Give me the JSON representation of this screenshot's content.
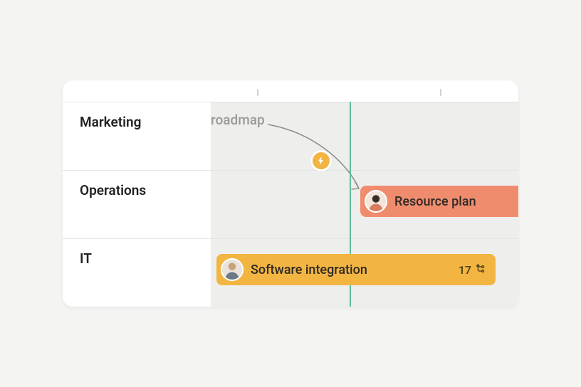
{
  "rows": [
    {
      "label": "Marketing"
    },
    {
      "label": "Operations"
    },
    {
      "label": "IT"
    }
  ],
  "ghost_task_label": "roadmap",
  "tasks": {
    "resource": {
      "title": "Resource plan",
      "color": "orange"
    },
    "software": {
      "title": "Software integration",
      "count": "17",
      "color": "yellow"
    }
  },
  "colors": {
    "today": "#5cbfa0",
    "bolt": "#f2b542",
    "bar_orange": "#f08c6e",
    "bar_yellow": "#f2b542"
  }
}
